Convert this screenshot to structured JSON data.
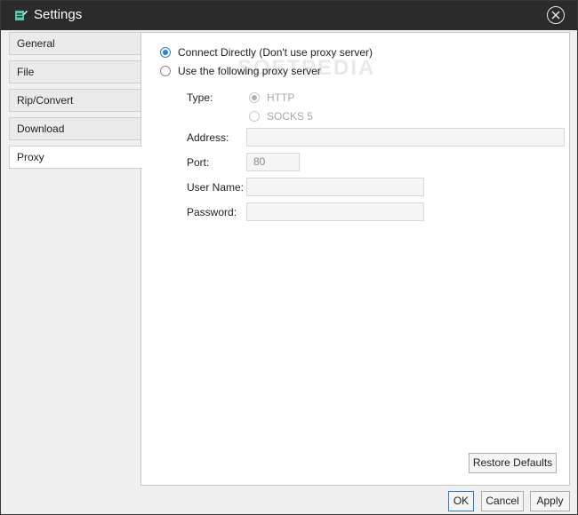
{
  "window": {
    "title": "Settings",
    "icons": {
      "app": "app-pencil-icon",
      "close": "close-icon"
    },
    "colors": {
      "titlebar": "#2b2b2b",
      "accent": "#2b7cd3"
    }
  },
  "sidebar": {
    "items": [
      {
        "label": "General"
      },
      {
        "label": "File"
      },
      {
        "label": "Rip/Convert"
      },
      {
        "label": "Download"
      },
      {
        "label": "Proxy"
      }
    ],
    "selected": "Proxy"
  },
  "proxy": {
    "connection_mode": {
      "direct_label": "Connect Directly (Don't use proxy server)",
      "proxy_label": "Use the following proxy server",
      "selected": "direct"
    },
    "type": {
      "label": "Type:",
      "http_label": "HTTP",
      "socks_label": "SOCKS 5",
      "selected": "HTTP"
    },
    "address": {
      "label": "Address:",
      "value": ""
    },
    "port": {
      "label": "Port:",
      "value": "80"
    },
    "username": {
      "label": "User Name:",
      "value": ""
    },
    "password": {
      "label": "Password:",
      "value": ""
    }
  },
  "watermark": "SOFTPEDIA",
  "buttons": {
    "restore_defaults": "Restore Defaults",
    "ok": "OK",
    "cancel": "Cancel",
    "apply": "Apply"
  }
}
